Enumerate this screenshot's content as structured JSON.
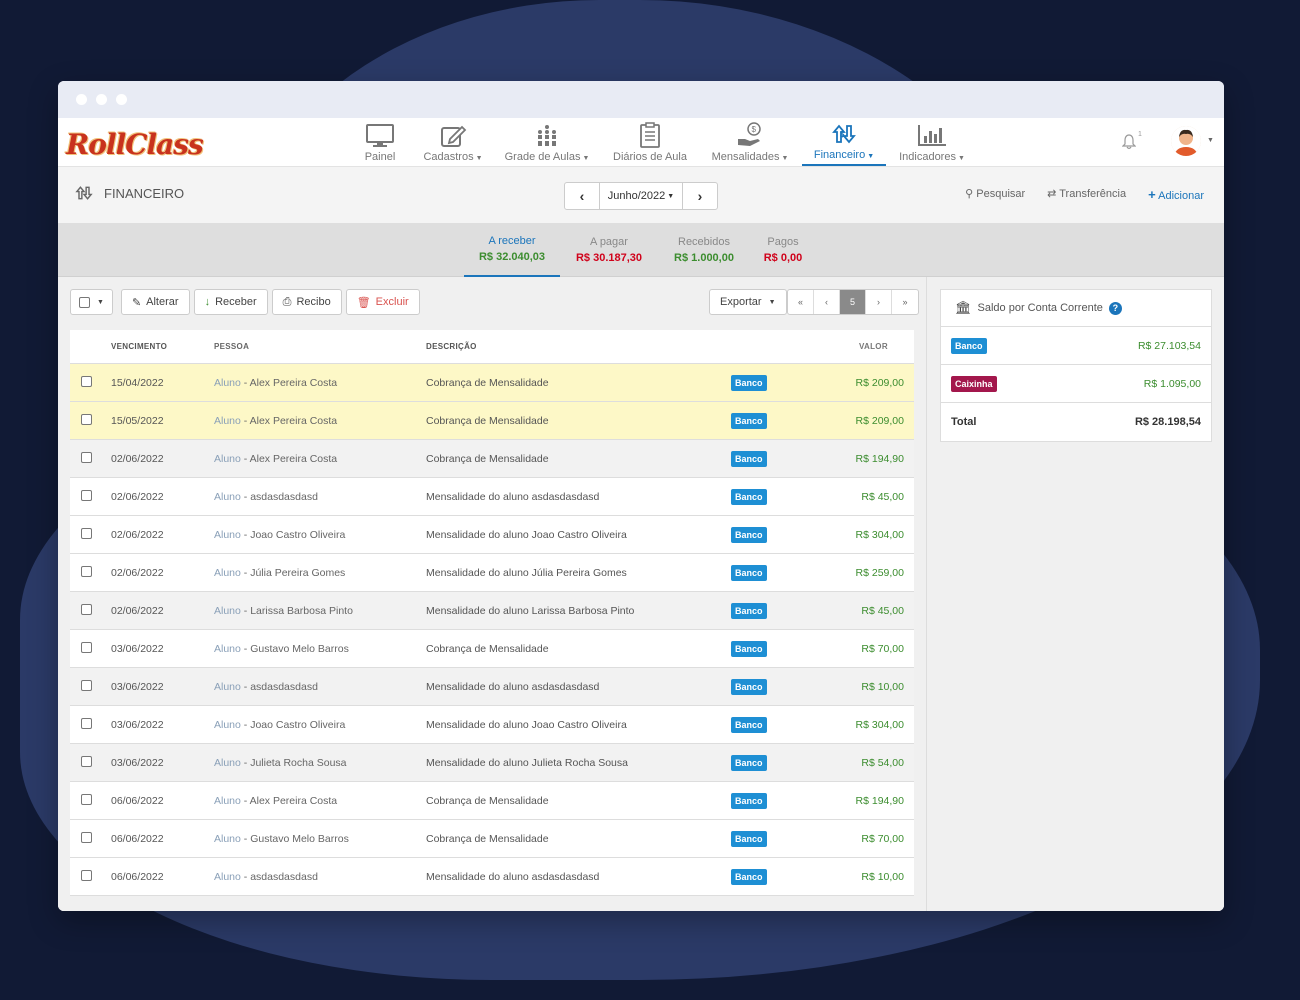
{
  "app": {
    "logo_text": "RollClass"
  },
  "nav": {
    "items": [
      {
        "label": "Painel",
        "icon": "monitor-icon",
        "caret": false
      },
      {
        "label": "Cadastros",
        "icon": "edit-icon",
        "caret": true
      },
      {
        "label": "Grade de Aulas",
        "icon": "grid-people-icon",
        "caret": true
      },
      {
        "label": "Diários de Aula",
        "icon": "clipboard-icon",
        "caret": false
      },
      {
        "label": "Mensalidades",
        "icon": "coin-hand-icon",
        "caret": true
      },
      {
        "label": "Financeiro",
        "icon": "finance-icon",
        "caret": true,
        "active": true
      },
      {
        "label": "Indicadores",
        "icon": "bar-chart-icon",
        "caret": true
      }
    ],
    "notification_count": "1"
  },
  "subheader": {
    "title": "FINANCEIRO",
    "month": "Junho/2022",
    "search_label": "Pesquisar",
    "transfer_label": "Transferência",
    "add_label": "Adicionar"
  },
  "summary_tabs": [
    {
      "label": "A receber",
      "amount": "R$ 32.040,03",
      "tone": "green",
      "active": true
    },
    {
      "label": "A pagar",
      "amount": "R$ 30.187,30",
      "tone": "red"
    },
    {
      "label": "Recebidos",
      "amount": "R$ 1.000,00",
      "tone": "green"
    },
    {
      "label": "Pagos",
      "amount": "R$ 0,00",
      "tone": "red"
    }
  ],
  "toolbar": {
    "alterar": "Alterar",
    "receber": "Receber",
    "recibo": "Recibo",
    "excluir": "Excluir",
    "exportar": "Exportar",
    "pager": [
      "«",
      "‹",
      "5",
      "›",
      "»"
    ]
  },
  "table": {
    "headers": {
      "vencimento": "VENCIMENTO",
      "pessoa": "PESSOA",
      "descricao": "DESCRIÇÃO",
      "valor": "VALOR"
    },
    "rows": [
      {
        "venc": "15/04/2022",
        "tipo": "Aluno",
        "nome": " - Alex Pereira Costa",
        "desc": "Cobrança de Mensalidade",
        "conta": "Banco",
        "valor": "R$ 209,00",
        "state": "overdue"
      },
      {
        "venc": "15/05/2022",
        "tipo": "Aluno",
        "nome": " - Alex Pereira Costa",
        "desc": "Cobrança de Mensalidade",
        "conta": "Banco",
        "valor": "R$ 209,00",
        "state": "overdue"
      },
      {
        "venc": "02/06/2022",
        "tipo": "Aluno",
        "nome": " - Alex Pereira Costa",
        "desc": "Cobrança de Mensalidade",
        "conta": "Banco",
        "valor": "R$ 194,90",
        "state": "alt"
      },
      {
        "venc": "02/06/2022",
        "tipo": "Aluno",
        "nome": " - asdasdasdasd",
        "desc": "Mensalidade do aluno asdasdasdasd",
        "conta": "Banco",
        "valor": "R$ 45,00",
        "state": ""
      },
      {
        "venc": "02/06/2022",
        "tipo": "Aluno",
        "nome": " - Joao Castro Oliveira",
        "desc": "Mensalidade do aluno Joao Castro Oliveira",
        "conta": "Banco",
        "valor": "R$ 304,00",
        "state": ""
      },
      {
        "venc": "02/06/2022",
        "tipo": "Aluno",
        "nome": " - Júlia Pereira Gomes",
        "desc": "Mensalidade do aluno Júlia Pereira Gomes",
        "conta": "Banco",
        "valor": "R$ 259,00",
        "state": ""
      },
      {
        "venc": "02/06/2022",
        "tipo": "Aluno",
        "nome": " - Larissa Barbosa Pinto",
        "desc": "Mensalidade do aluno Larissa Barbosa Pinto",
        "conta": "Banco",
        "valor": "R$ 45,00",
        "state": "alt"
      },
      {
        "venc": "03/06/2022",
        "tipo": "Aluno",
        "nome": " - Gustavo Melo Barros",
        "desc": "Cobrança de Mensalidade",
        "conta": "Banco",
        "valor": "R$ 70,00",
        "state": ""
      },
      {
        "venc": "03/06/2022",
        "tipo": "Aluno",
        "nome": " - asdasdasdasd",
        "desc": "Mensalidade do aluno asdasdasdasd",
        "conta": "Banco",
        "valor": "R$ 10,00",
        "state": "alt"
      },
      {
        "venc": "03/06/2022",
        "tipo": "Aluno",
        "nome": " - Joao Castro Oliveira",
        "desc": "Mensalidade do aluno Joao Castro Oliveira",
        "conta": "Banco",
        "valor": "R$ 304,00",
        "state": ""
      },
      {
        "venc": "03/06/2022",
        "tipo": "Aluno",
        "nome": " - Julieta Rocha Sousa",
        "desc": "Mensalidade do aluno Julieta Rocha Sousa",
        "conta": "Banco",
        "valor": "R$ 54,00",
        "state": "alt"
      },
      {
        "venc": "06/06/2022",
        "tipo": "Aluno",
        "nome": " - Alex Pereira Costa",
        "desc": "Cobrança de Mensalidade",
        "conta": "Banco",
        "valor": "R$ 194,90",
        "state": ""
      },
      {
        "venc": "06/06/2022",
        "tipo": "Aluno",
        "nome": " - Gustavo Melo Barros",
        "desc": "Cobrança de Mensalidade",
        "conta": "Banco",
        "valor": "R$ 70,00",
        "state": ""
      },
      {
        "venc": "06/06/2022",
        "tipo": "Aluno",
        "nome": " - asdasdasdasd",
        "desc": "Mensalidade do aluno asdasdasdasd",
        "conta": "Banco",
        "valor": "R$ 10,00",
        "state": ""
      }
    ]
  },
  "saldo": {
    "title": "Saldo por Conta Corrente",
    "help": "?",
    "accounts": [
      {
        "name": "Banco",
        "amount": "R$ 27.103,54",
        "color": "#1e8fd4"
      },
      {
        "name": "Caixinha",
        "amount": "R$ 1.095,00",
        "color": "#a3174c"
      }
    ],
    "total_label": "Total",
    "total_amount": "R$ 28.198,54"
  }
}
